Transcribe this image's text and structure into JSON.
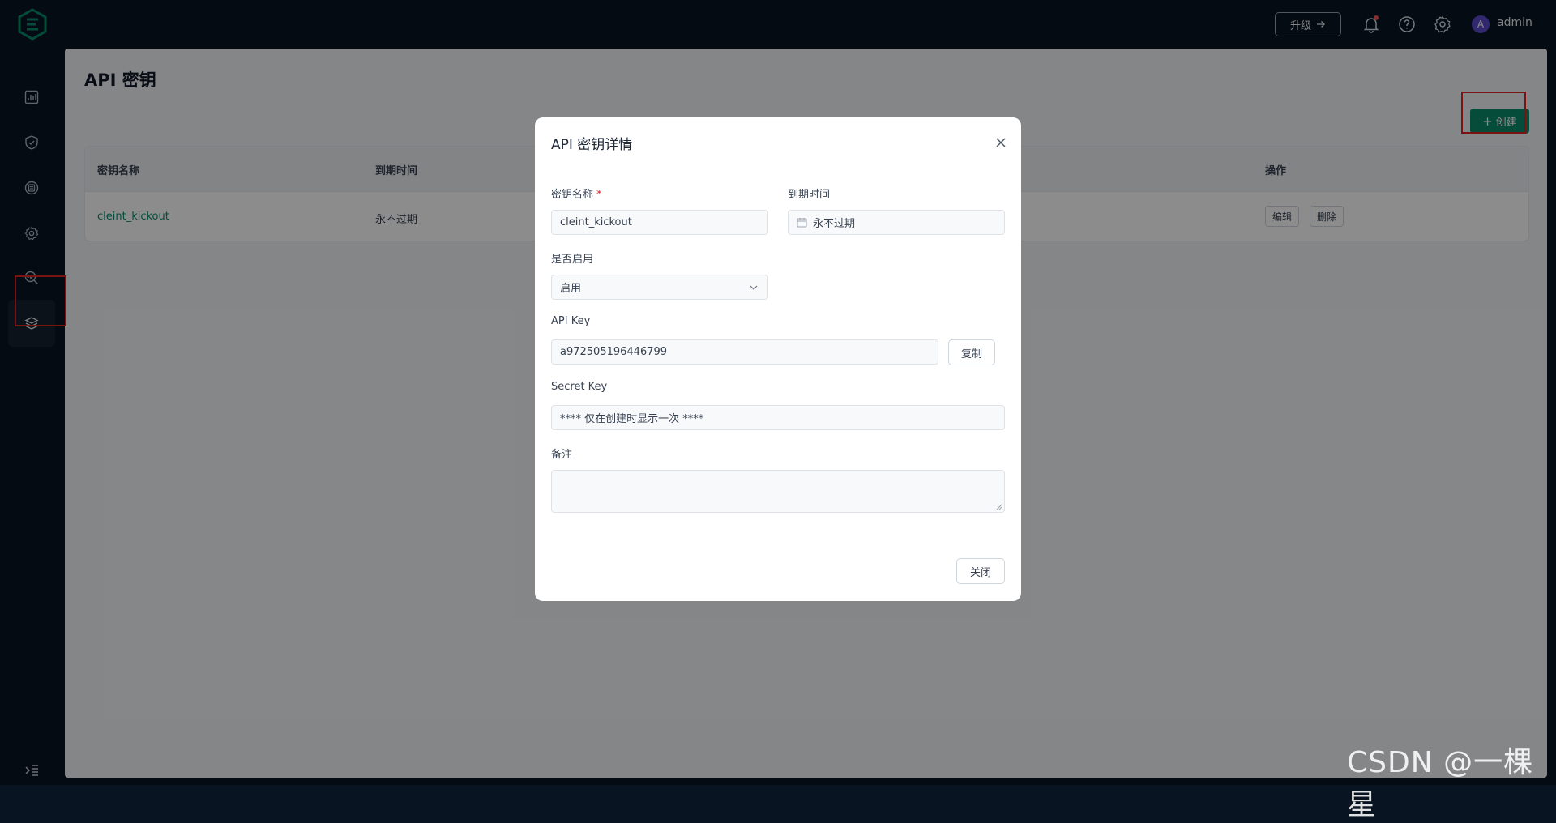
{
  "topbar": {
    "upgrade_label": "升级",
    "user_avatar_letter": "A",
    "user_name": "admin"
  },
  "sidebar": {
    "items": [
      {
        "icon": "dashboard-chart-icon"
      },
      {
        "icon": "shield-check-icon"
      },
      {
        "icon": "clients-icon"
      },
      {
        "icon": "gear-cog-icon"
      },
      {
        "icon": "diagnose-search-icon"
      },
      {
        "icon": "api-layers-icon",
        "active": true
      }
    ]
  },
  "page": {
    "title": "API 密钥",
    "create_label": "创建",
    "columns": {
      "name": "密钥名称",
      "expire": "到期时间",
      "actions": "操作"
    },
    "rows": [
      {
        "name": "cleint_kickout",
        "expire": "永不过期",
        "edit": "编辑",
        "delete": "删除"
      }
    ]
  },
  "modal": {
    "title": "API 密钥详情",
    "name_label": "密钥名称",
    "name_required": "*",
    "name_value": "cleint_kickout",
    "expire_label": "到期时间",
    "expire_value": "永不过期",
    "enable_label": "是否启用",
    "enable_value": "启用",
    "api_key_label": "API Key",
    "api_key_value": "a972505196446799",
    "copy_label": "复制",
    "secret_key_label": "Secret Key",
    "secret_key_value": "**** 仅在创建时显示一次 ****",
    "note_label": "备注",
    "note_value": "",
    "close_label": "关闭"
  },
  "watermark": "CSDN @一棵星",
  "colors": {
    "accent": "#0c8a6c",
    "sidebar_bg": "#081421",
    "highlight_box": "#e02424"
  }
}
